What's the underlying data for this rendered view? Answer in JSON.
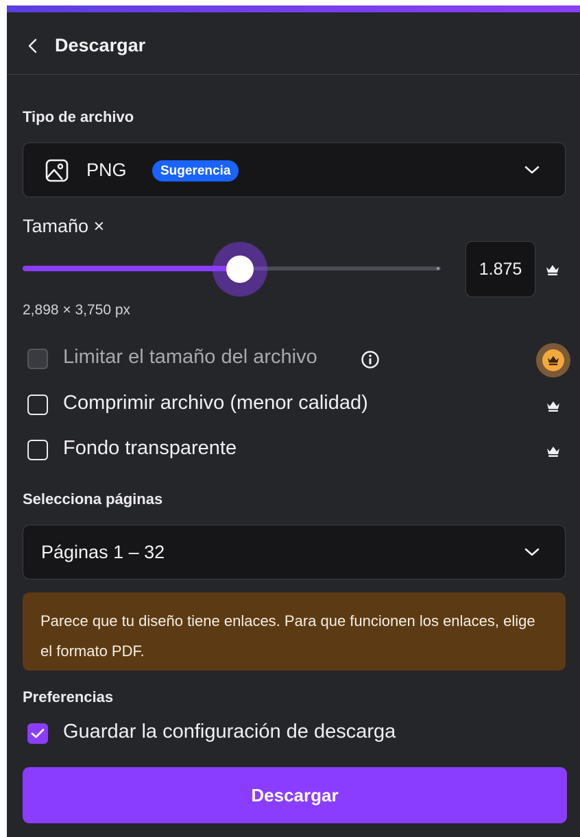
{
  "header": {
    "title": "Descargar"
  },
  "file_type": {
    "label": "Tipo de archivo",
    "value": "PNG",
    "badge": "Sugerencia"
  },
  "size": {
    "label": "Tamaño ×",
    "value": "1.875",
    "slider_fraction": 0.52,
    "dimensions": "2,898 × 3,750 px"
  },
  "options": {
    "limit_size": {
      "label": "Limitar el tamaño del archivo",
      "checked": false,
      "disabled": true
    },
    "compress": {
      "label": "Comprimir archivo (menor calidad)",
      "checked": false
    },
    "transparent": {
      "label": "Fondo transparente",
      "checked": false
    }
  },
  "pages": {
    "label": "Selecciona páginas",
    "value": "Páginas 1 – 32"
  },
  "notice": {
    "text": "Parece que tu diseño tiene enlaces. Para que funcionen los enlaces, elige el formato PDF."
  },
  "preferences": {
    "label": "Preferencias",
    "save_settings": {
      "label": "Guardar la configuración de descarga",
      "checked": true
    }
  },
  "download_button": {
    "label": "Descargar"
  },
  "colors": {
    "accent": "#8b3dff",
    "panel_bg": "#252629",
    "notice_bg": "#5c3b14",
    "badge_bg": "#1a63ff"
  },
  "icons": [
    "back-arrow",
    "image-file",
    "chevron-down",
    "crown",
    "info",
    "checkmark"
  ]
}
